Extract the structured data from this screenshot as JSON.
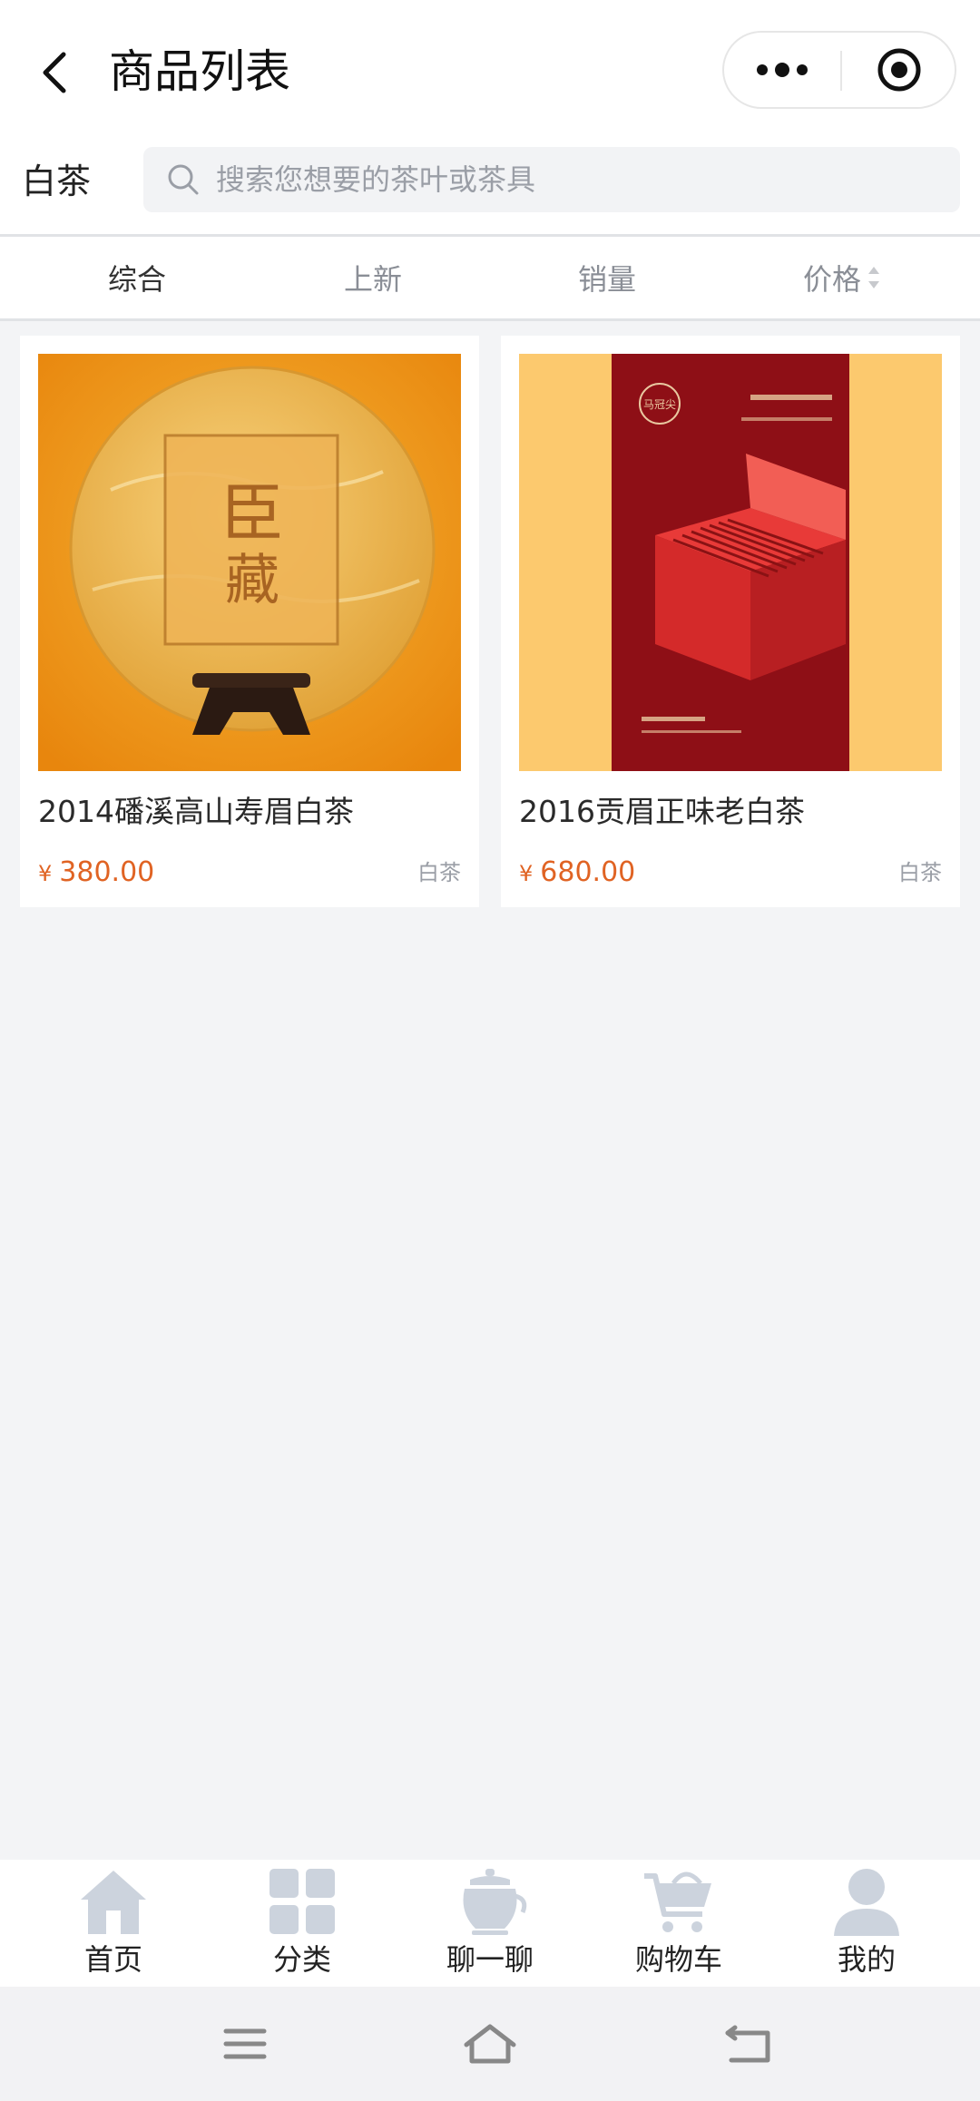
{
  "header": {
    "title": "商品列表"
  },
  "search": {
    "category": "白茶",
    "placeholder": "搜索您想要的茶叶或茶具"
  },
  "sort": {
    "items": [
      {
        "label": "综合",
        "active": true
      },
      {
        "label": "上新",
        "active": false
      },
      {
        "label": "销量",
        "active": false
      },
      {
        "label": "价格",
        "active": false,
        "sortable": true
      }
    ]
  },
  "products": [
    {
      "name": "2014磻溪高山寿眉白茶",
      "currency": "¥",
      "price": "380.00",
      "tag": "白茶",
      "image_icon": "tea-cake-image",
      "image_text": "臣藏"
    },
    {
      "name": "2016贡眉正味老白茶",
      "currency": "¥",
      "price": "680.00",
      "tag": "白茶",
      "image_icon": "tea-gift-box-image",
      "image_text": "马冠尖"
    }
  ],
  "tabbar": {
    "items": [
      {
        "label": "首页",
        "icon": "home-icon"
      },
      {
        "label": "分类",
        "icon": "category-grid-icon"
      },
      {
        "label": "聊一聊",
        "icon": "teapot-chat-icon"
      },
      {
        "label": "购物车",
        "icon": "cart-icon"
      },
      {
        "label": "我的",
        "icon": "user-icon"
      }
    ]
  },
  "colors": {
    "price": "#e06323",
    "icon_grey": "#ccd3dd",
    "background": "#f3f4f6"
  }
}
